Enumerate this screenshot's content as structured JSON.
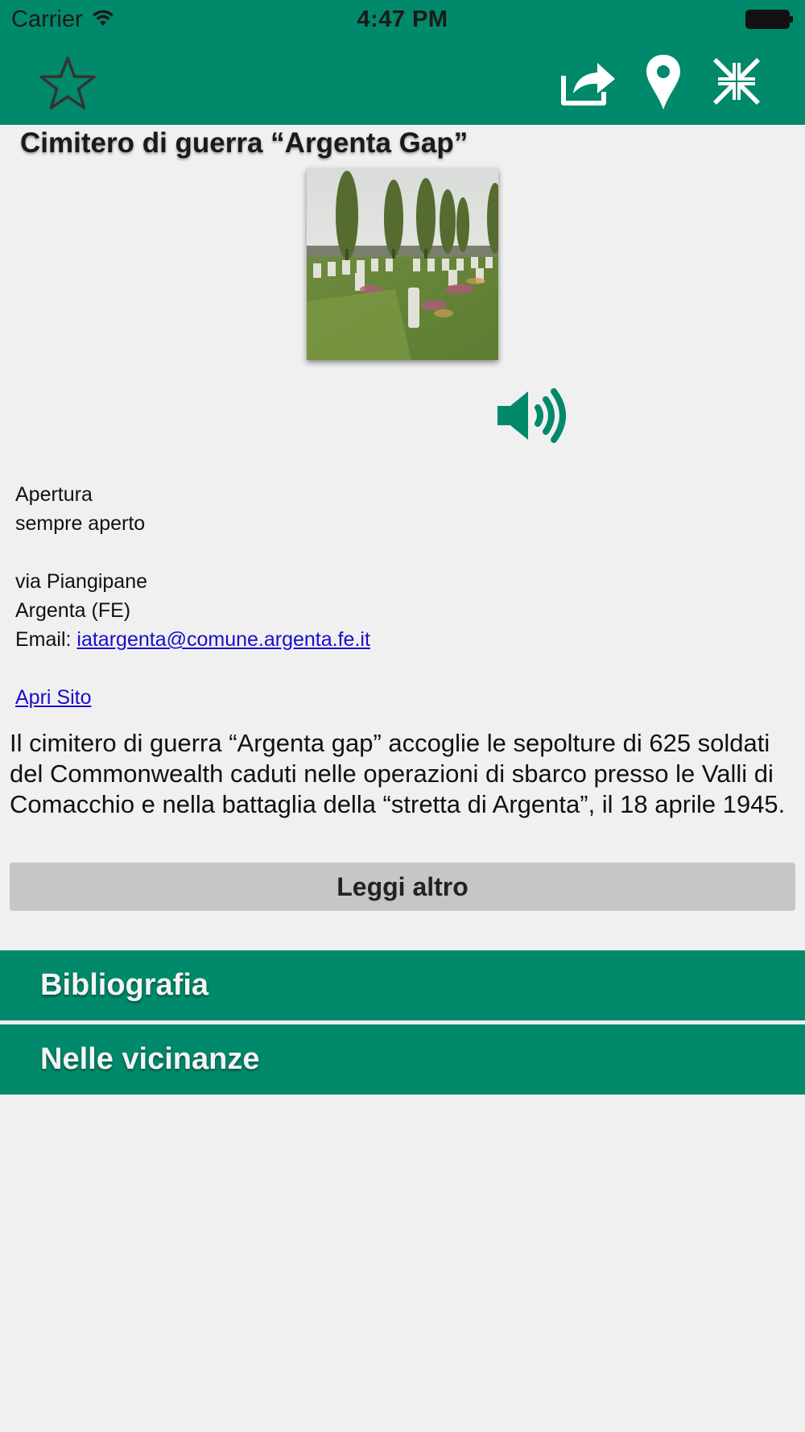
{
  "status_bar": {
    "carrier": "Carrier",
    "time": "4:47 PM"
  },
  "toolbar": {
    "icons": [
      "star-icon",
      "share-icon",
      "map-pin-icon",
      "collapse-icon"
    ]
  },
  "colors": {
    "brand_green": "#00896a",
    "background": "#f0f0f0",
    "link": "#1a0dcc",
    "button_gray": "#c6c6c6"
  },
  "title": "Cimitero di guerra “Argenta Gap”",
  "info": {
    "opening_label": "Apertura",
    "opening_value": "sempre aperto",
    "address_street": "via Piangipane",
    "address_city": "Argenta (FE)",
    "email_label": "Email: ",
    "email": "iatargenta@comune.argenta.fe.it",
    "site_link": "Apri Sito"
  },
  "description": "Il cimitero di guerra “Argenta gap” accoglie le sepolture di  625 soldati del Commonwealth caduti nelle operazioni di sbarco presso le Valli di Comacchio e nella battaglia della “stretta di Argenta”, il 18 aprile 1945.",
  "read_more_label": "Leggi altro",
  "sections": {
    "bibliografia": "Bibliografia",
    "vicinanze": "Nelle vicinanze"
  }
}
